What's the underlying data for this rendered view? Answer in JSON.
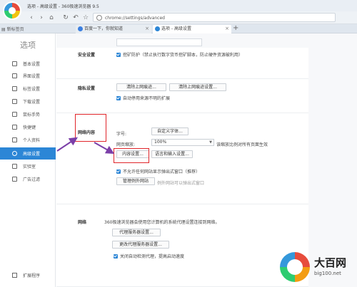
{
  "window": {
    "title": "选项 - 高级设置 - 360极速浏览器 9.5"
  },
  "toolbar": {
    "address": "chrome://settings/advanced"
  },
  "tabbar": {
    "favorites_label": "新标签页",
    "tabs": [
      {
        "label": "百度一下，你就知道",
        "active": false
      },
      {
        "label": "选项 - 高级设置",
        "active": true
      }
    ],
    "add_tab": "+"
  },
  "sidebar": {
    "title": "选项",
    "items": [
      {
        "label": "基本设置",
        "icon": "home-icon"
      },
      {
        "label": "界面设置",
        "icon": "window-icon"
      },
      {
        "label": "标签设置",
        "icon": "tab-icon"
      },
      {
        "label": "下载设置",
        "icon": "download-icon"
      },
      {
        "label": "鼠标手势",
        "icon": "mouse-icon"
      },
      {
        "label": "快捷键",
        "icon": "keyboard-icon"
      },
      {
        "label": "个人资料",
        "icon": "user-icon"
      },
      {
        "label": "高级设置",
        "icon": "gear-icon",
        "active": true
      },
      {
        "label": "实验室",
        "icon": "flask-icon"
      },
      {
        "label": "广告过滤",
        "icon": "block-icon"
      }
    ],
    "bottom": {
      "label": "扩展程序",
      "icon": "puzzle-icon"
    }
  },
  "security": {
    "title": "安全设置",
    "hijack_protect": "挖矿防护（禁止执行数字货币挖矿脚本，防止硬件资源被利用）"
  },
  "privacy": {
    "title": "隐私设置",
    "clear_button": "清除上网痕迹...",
    "clear_settings_button": "清除上网痕迹设置...",
    "auto_disable_ext": "自动停用来源不明的扩展"
  },
  "web_content": {
    "title": "网络内容",
    "font_label": "字号:",
    "font_button": "自定义字体...",
    "zoom_label": "网页缩放:",
    "zoom_value": "100%",
    "zoom_hint": "该缩放比例对所有页面生效",
    "content_settings_button": "内容设置...",
    "language_button": "语言和输入设置...",
    "popup_block": "不允许任何网站显示弹出式窗口（推荐）",
    "manage_exceptions_button": "管理例外网站",
    "exceptions_hint": "例外网站可以弹出式窗口"
  },
  "network": {
    "title": "网络",
    "description": "360极速浏览器会使用您计算机的系统代理设置连接到网络。",
    "proxy_button": "代理服务器设置...",
    "proxy_switch_button": "更改代理服务器设置...",
    "auto_detect": "关闭自动检测代理，提高启动速度"
  },
  "watermark": {
    "title": "大百网",
    "subtitle": "big100.net"
  },
  "colors": {
    "accent": "#2c86d6",
    "highlight": "#e0252a",
    "arrow": "#7b3fa8"
  }
}
